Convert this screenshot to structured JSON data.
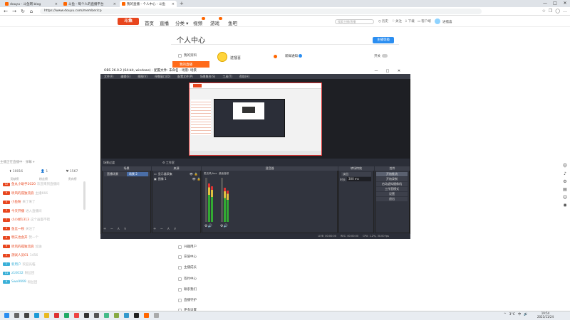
{
  "browser": {
    "tabs": [
      {
        "title": "douyu - 斗鱼网 blog",
        "active": false
      },
      {
        "title": "斗鱼 - 每个人的直播平台",
        "active": false
      },
      {
        "title": "我的直播 - 个人中心 - 斗鱼",
        "active": true
      }
    ],
    "url": "https://www.douyu.com/member/cp",
    "window_controls": [
      "—",
      "□",
      "✕"
    ]
  },
  "site": {
    "logo": "斗鱼",
    "nav": [
      "首页",
      "直播",
      "分类 ▾",
      "视频",
      "游戏",
      "鱼吧"
    ],
    "search_placeholder": "搜索主播/直播",
    "header_links": [
      "历史",
      "关注",
      "下载",
      "客户端"
    ],
    "username": "进擂喜"
  },
  "page": {
    "title": "个人中心",
    "anchor_button": "主播等级",
    "menu_top": [
      "我的资料",
      "我的直播"
    ],
    "active_menu": "我的直播",
    "profile_name": "进擂喜",
    "notify_label": "新鲜通知",
    "switch_label": "开关",
    "menu_bottom": [
      "兴趣用户",
      "充值中心",
      "主播成长",
      "签约中心",
      "联系我们",
      "直播守护",
      "更多设置"
    ]
  },
  "chat": {
    "top_line": "主播正在直播中 · 弹幕 ▾",
    "stats": [
      "⬆ 10016",
      "👤 1",
      "♥ 1567"
    ],
    "sub": [
      "贡献榜",
      "粉丝榜",
      "贵宾榜"
    ],
    "rows": [
      {
        "nick": "鱼丸小助手2020",
        "msg": "欢迎来到直播间",
        "lvl": "12",
        "color": "#e8461e"
      },
      {
        "nick": "听风的孤独流浪",
        "msg": "主播666",
        "lvl": "9",
        "color": "#e8461e"
      },
      {
        "nick": "小鱼粉",
        "msg": "来了来了",
        "lvl": "5",
        "color": "#e8461e"
      },
      {
        "nick": "今天开播",
        "msg": "进入直播间",
        "lvl": "3",
        "color": "#e8461e"
      },
      {
        "nick": "小小娇1313",
        "msg": "这个画面不错",
        "lvl": "7",
        "color": "#e8461e"
      },
      {
        "nick": "鱼丝一枚",
        "msg": "关注了",
        "lvl": "4",
        "color": "#e8461e"
      },
      {
        "nick": "明天也会开",
        "msg": "赞一个",
        "lvl": "6",
        "color": "#e8461e"
      },
      {
        "nick": "听风的孤独流浪",
        "msg": "加油",
        "lvl": "9",
        "color": "#e8461e"
      },
      {
        "nick": "测试人员01",
        "msg": "1456",
        "lvl": "2",
        "color": "#e8461e"
      },
      {
        "nick": "新用户",
        "msg": "欢迎光临",
        "lvl": "1",
        "color": "#3ab0d8"
      },
      {
        "nick": "z10032",
        "msg": "粉丝团",
        "lvl": "11",
        "color": "#3ab0d8"
      },
      {
        "nick": "Swe9999",
        "msg": "粉丝团",
        "lvl": "8",
        "color": "#3ab0d8"
      }
    ]
  },
  "right_tools": [
    "中",
    "♪",
    "⚙",
    "▤",
    "☺",
    "◉"
  ],
  "obs": {
    "title": "OBS 26.0.2 (64-bit, windows) - 配置文件: 未命名 - 场景: 场景",
    "menu": [
      "文件(F)",
      "编辑(E)",
      "视图(V)",
      "停靠窗口(D)",
      "配置文件(P)",
      "场景集合(S)",
      "工具(T)",
      "帮助(H)"
    ],
    "scene_label": "场景过渡",
    "preview_tools": "⚙ 工作室",
    "docks": {
      "scenes": "场景",
      "sources": "来源",
      "mixer": "混音器",
      "transitions": "转场特效",
      "controls": "控件"
    },
    "scene_items": [
      "直播场景",
      "场景 2"
    ],
    "sources": [
      "显示器采集",
      "图像 1"
    ],
    "mixer_labels": [
      "麦克风/Aux",
      "桌面音频"
    ],
    "transition": "淡出",
    "duration_label": "时长",
    "duration_value": "300 ms",
    "controls": [
      "开始推流",
      "开始录制",
      "启动虚拟摄像机",
      "工作室模式",
      "设置",
      "退出"
    ],
    "status": [
      "LIVE: 00:00:00",
      "REC: 00:00:00",
      "CPU: 1.2%, 30.00 fps"
    ],
    "dock_footer": "+ − ∧ ∨"
  },
  "taskbar": {
    "tray": [
      "^",
      "3°C",
      "中",
      "🔊"
    ],
    "time": "19:54",
    "date": "2021/11/24"
  }
}
